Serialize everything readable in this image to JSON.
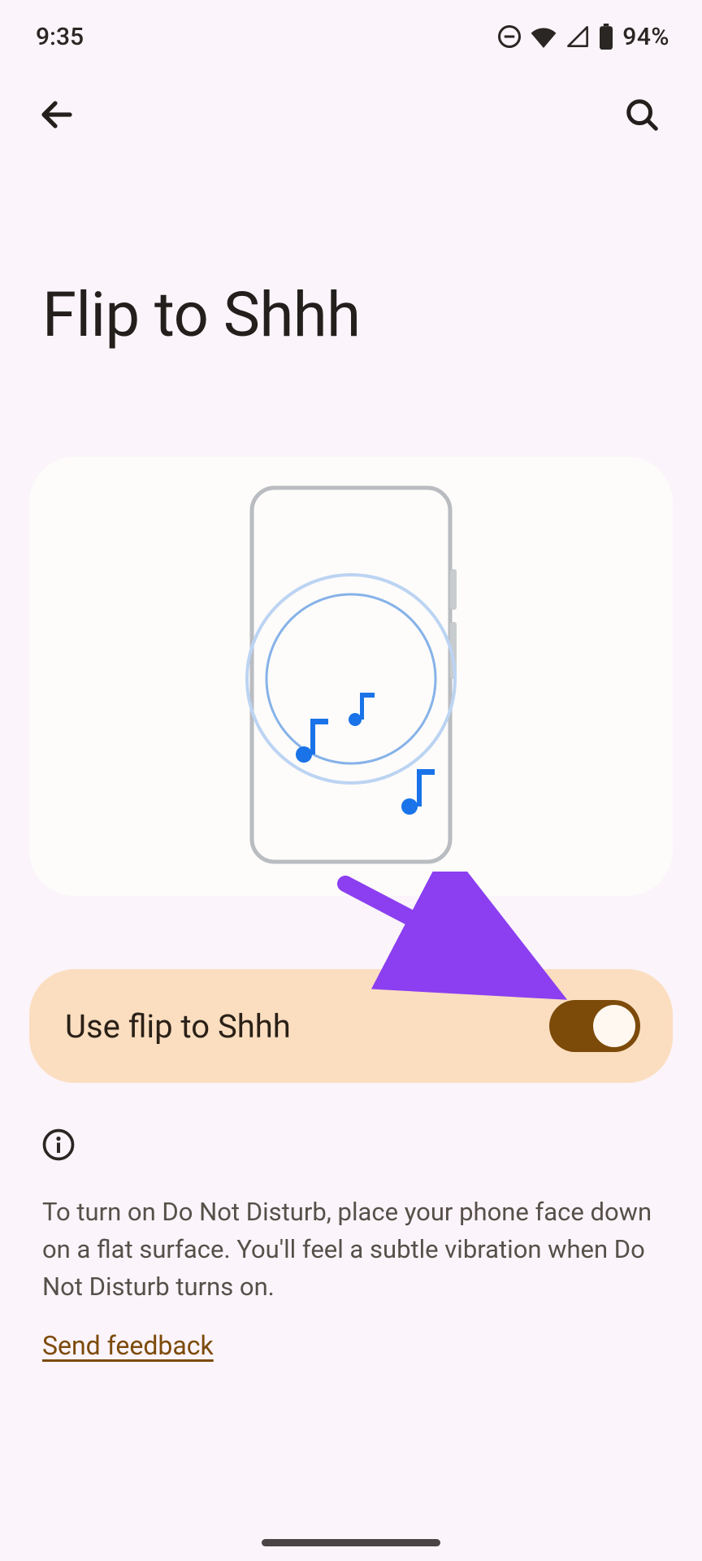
{
  "status": {
    "time": "9:35",
    "battery_pct": "94%"
  },
  "page": {
    "title": "Flip to Shhh"
  },
  "toggle": {
    "label": "Use flip to Shhh",
    "on": true
  },
  "info": {
    "text": "To turn on Do Not Disturb, place your phone face down on a flat surface. You'll feel a subtle vibration when Do Not Disturb turns on.",
    "feedback_label": "Send feedback"
  },
  "colors": {
    "accent": "#7c4a09",
    "card": "#fbdec0",
    "annotation": "#8b3ff0"
  }
}
